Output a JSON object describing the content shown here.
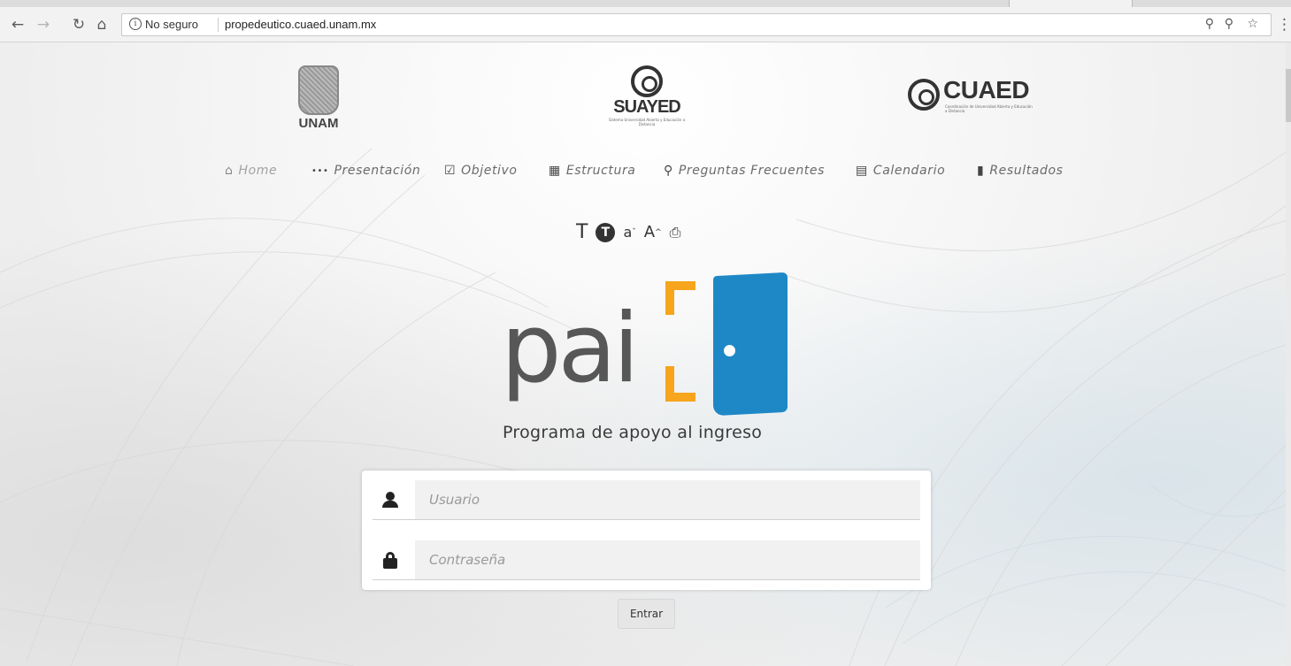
{
  "browser": {
    "back_icon": "arrow-left-icon",
    "forward_icon": "arrow-right-icon",
    "reload_icon": "reload-icon",
    "home_icon": "home-icon",
    "security_label": "No seguro",
    "url": "propedeutico.cuaed.unam.mx",
    "zoom_icon": "zoom-icon",
    "key_icon": "key-icon",
    "star_icon": "star-icon",
    "menu_icon": "kebab-menu-icon"
  },
  "logos": {
    "unam": "UNAM",
    "suayed": "SUAYED",
    "suayed_caption": "Sistema Universidad Abierta y Educación a Distancia",
    "cuaed": "CUAED",
    "cuaed_caption": "Coordinación de Universidad Abierta y Educación a Distancia"
  },
  "menu": {
    "items": [
      {
        "label": "Home",
        "icon": "home-icon",
        "active": true
      },
      {
        "label": "Presentación",
        "icon": "ellipsis-icon"
      },
      {
        "label": "Objetivo",
        "icon": "check-square-icon"
      },
      {
        "label": "Estructura",
        "icon": "sitemap-icon"
      },
      {
        "label": "Preguntas Frecuentes",
        "icon": "search-icon"
      },
      {
        "label": "Calendario",
        "icon": "calendar-icon"
      },
      {
        "label": "Resultados",
        "icon": "file-icon"
      }
    ]
  },
  "a11y": {
    "font_normal": "T",
    "font_contrast": "T",
    "font_decrease": "a",
    "font_increase": "A",
    "print_icon": "print-icon"
  },
  "pai": {
    "wordmark": "pai",
    "subtitle": "Programa de apoyo al ingreso",
    "colors": {
      "bracket": "#f7a51c",
      "door": "#1e88c7",
      "text": "#575757"
    }
  },
  "login": {
    "user_placeholder": "Usuario",
    "user_value": "",
    "password_placeholder": "Contraseña",
    "password_value": "",
    "submit_label": "Entrar"
  }
}
